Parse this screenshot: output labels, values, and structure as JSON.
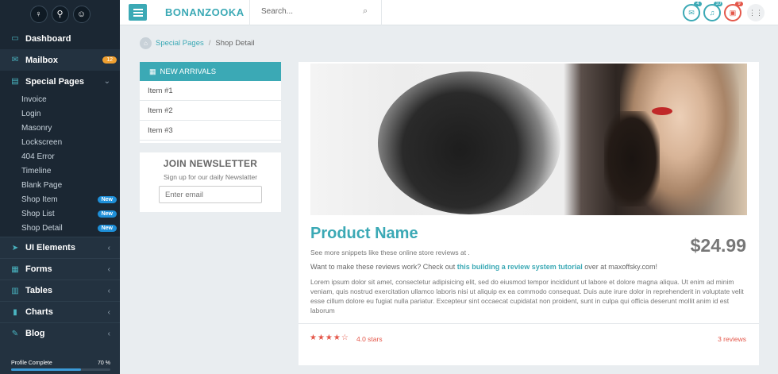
{
  "sidebar": {
    "top_buttons": [
      {
        "icon": "user-icon",
        "glyph": "♀"
      },
      {
        "icon": "link-icon",
        "glyph": "⚲"
      },
      {
        "icon": "smile-icon",
        "glyph": "☺"
      }
    ],
    "menu": [
      {
        "label": "Dashboard",
        "icon": "monitor-icon"
      },
      {
        "label": "Mailbox",
        "icon": "mail-icon",
        "badge": "12"
      },
      {
        "label": "Special Pages",
        "icon": "pages-icon"
      }
    ],
    "special_pages": [
      {
        "label": "Invoice"
      },
      {
        "label": "Login"
      },
      {
        "label": "Masonry"
      },
      {
        "label": "Lockscreen"
      },
      {
        "label": "404 Error"
      },
      {
        "label": "Timeline"
      },
      {
        "label": "Blank Page"
      },
      {
        "label": "Shop Item",
        "badge": "New"
      },
      {
        "label": "Shop List",
        "badge": "New"
      },
      {
        "label": "Shop Detail",
        "badge": "New"
      }
    ],
    "menu_after": [
      {
        "label": "UI Elements",
        "icon": "send-icon"
      },
      {
        "label": "Forms",
        "icon": "form-icon"
      },
      {
        "label": "Tables",
        "icon": "table-icon"
      },
      {
        "label": "Charts",
        "icon": "chart-icon"
      },
      {
        "label": "Blog",
        "icon": "blog-icon"
      }
    ],
    "profile": {
      "label": "Profile Complete",
      "value": "70 %",
      "progress": 0.7
    }
  },
  "header": {
    "brand": "BONANZOOKA",
    "search_placeholder": "Search...",
    "notifications": [
      {
        "icon": "envelope-icon",
        "count": "4"
      },
      {
        "icon": "bell-icon",
        "count": "10"
      },
      {
        "icon": "task-icon",
        "count": "9"
      }
    ]
  },
  "breadcrumb": {
    "parent": "Special Pages",
    "current": "Shop Detail"
  },
  "arrivals": {
    "title": "NEW ARRIVALS",
    "items": [
      "Item #1",
      "Item #2",
      "Item #3"
    ]
  },
  "newsletter": {
    "title": "JOIN NEWSLETTER",
    "subtitle": "Sign up for our daily Newslatter",
    "placeholder": "Enter email"
  },
  "product": {
    "name": "Product Name",
    "price": "$24.99",
    "snippet": "See more snippets like these online store reviews at .",
    "review_prefix": "Want to make these reviews work? Check out ",
    "review_link": "this building a review system tutorial",
    "review_suffix": " over at maxoffsky.com!",
    "description": "Lorem ipsum dolor sit amet, consectetur adipisicing elit, sed do eiusmod tempor incididunt ut labore et dolore magna aliqua. Ut enim ad minim veniam, quis nostrud exercitation ullamco laboris nisi ut aliquip ex ea commodo consequat. Duis aute irure dolor in reprehenderit in voluptate velit esse cillum dolore eu fugiat nulla pariatur. Excepteur sint occaecat cupidatat non proident, sunt in culpa qui officia deserunt mollit anim id est laborum",
    "stars": "★★★★☆",
    "rating_text": "4.0 stars",
    "reviews_text": "3 reviews"
  }
}
